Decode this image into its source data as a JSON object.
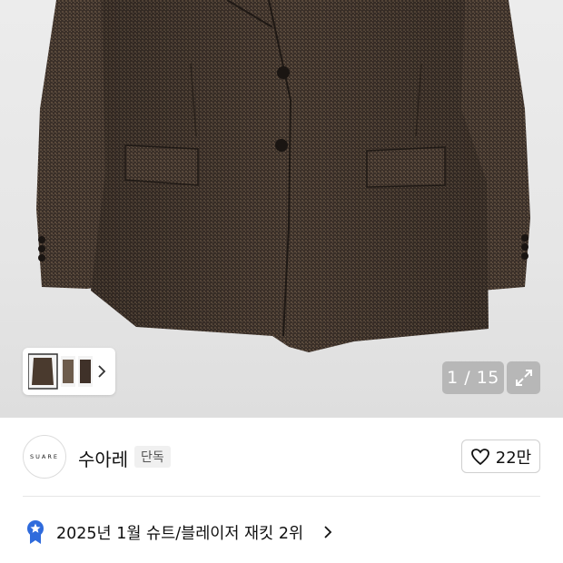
{
  "product_image": {
    "alt": "jacket-photo"
  },
  "gallery": {
    "pager": "1 / 15",
    "thumbnails_count": 3
  },
  "brand": {
    "logo_text": "SUARE",
    "name": "수아레",
    "badge": "단독",
    "likes": "22만"
  },
  "ranking": {
    "text": "2025년 1월 슈트/블레이저 재킷 2위"
  },
  "colors": {
    "accent_blue": "#2f6bdc",
    "jacket_brown": "#3a2f27"
  },
  "icons": {
    "expand": "expand-icon",
    "heart": "heart-icon",
    "ranking": "ranking-badge-icon",
    "chevron": "chevron-right-icon"
  }
}
